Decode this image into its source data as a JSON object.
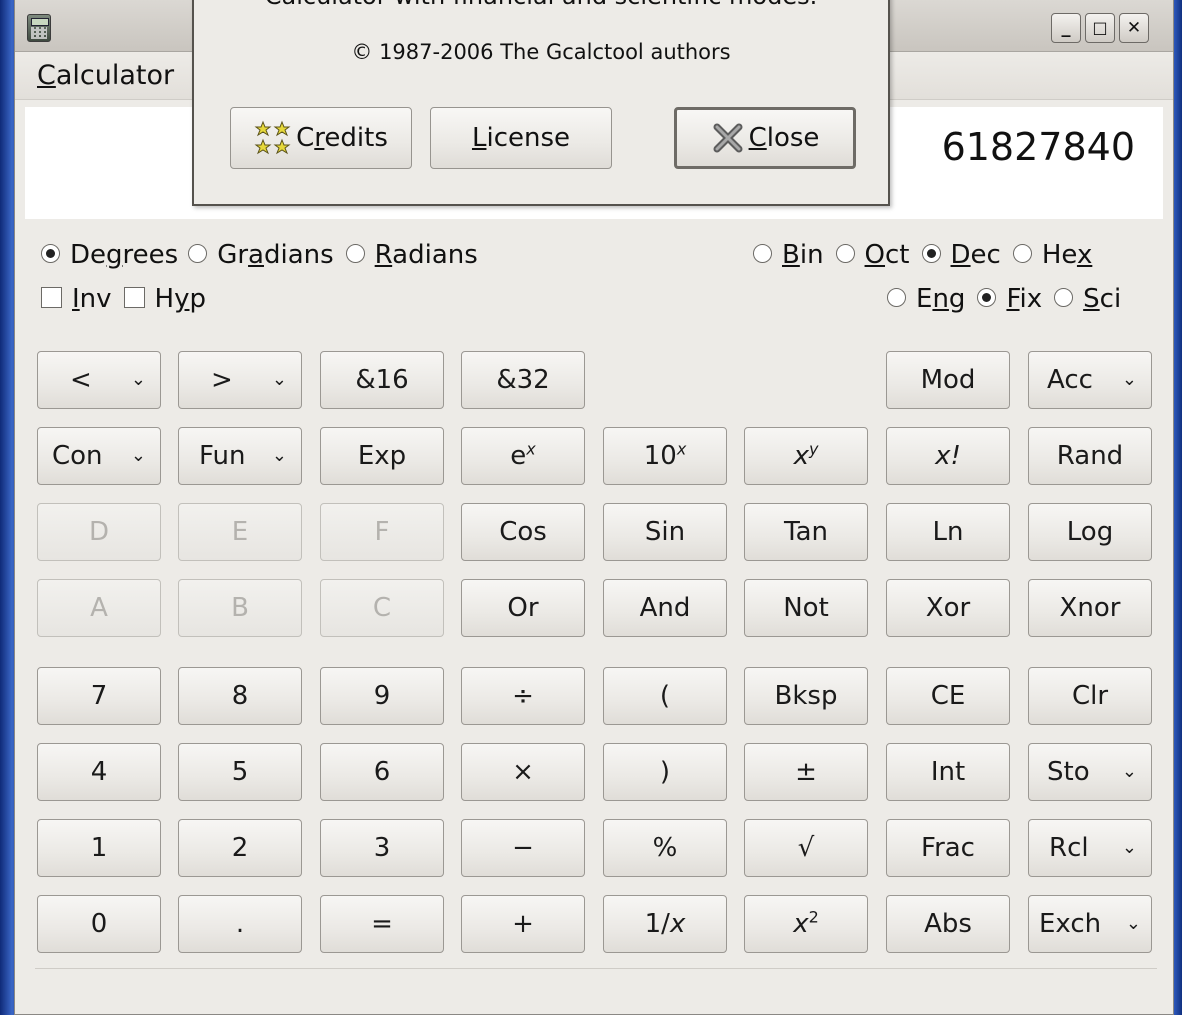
{
  "window": {
    "title_buttons": {
      "minimize": "_",
      "maximize": "□",
      "close": "✕"
    }
  },
  "menu": {
    "calculator": {
      "before": "",
      "mnemonic": "C",
      "after": "alculator"
    }
  },
  "display": {
    "value": "61827840"
  },
  "angle_modes": [
    {
      "pre": "De",
      "mn": "g",
      "post": "rees",
      "selected": true
    },
    {
      "pre": "Gr",
      "mn": "a",
      "post": "dians",
      "selected": false
    },
    {
      "pre": "",
      "mn": "R",
      "post": "adians",
      "selected": false
    }
  ],
  "base_modes": [
    {
      "pre": "",
      "mn": "B",
      "post": "in",
      "selected": false
    },
    {
      "pre": "",
      "mn": "O",
      "post": "ct",
      "selected": false
    },
    {
      "pre": "",
      "mn": "D",
      "post": "ec",
      "selected": true
    },
    {
      "pre": "He",
      "mn": "x",
      "post": "",
      "selected": false
    }
  ],
  "toggles": [
    {
      "pre": "",
      "mn": "I",
      "post": "nv",
      "checked": false
    },
    {
      "pre": "H",
      "mn": "y",
      "post": "p",
      "checked": false
    }
  ],
  "display_modes": [
    {
      "pre": "E",
      "mn": "n",
      "post": "g",
      "selected": false
    },
    {
      "pre": "",
      "mn": "F",
      "post": "ix",
      "selected": true
    },
    {
      "pre": "",
      "mn": "S",
      "post": "ci",
      "selected": false
    }
  ],
  "keys": {
    "shift_left": "<",
    "shift_right": ">",
    "and16": "&16",
    "and32": "&32",
    "mod": "Mod",
    "acc": "Acc",
    "con": "Con",
    "fun": "Fun",
    "exp": "Exp",
    "ex_base": "e",
    "ex_sup": "x",
    "tenx_base": "10",
    "tenx_sup": "x",
    "xy_base": "x",
    "xy_sup": "y",
    "fact": "x!",
    "rand": "Rand",
    "d": "D",
    "e": "E",
    "f": "F",
    "cos": "Cos",
    "sin": "Sin",
    "tan": "Tan",
    "ln": "Ln",
    "log": "Log",
    "a": "A",
    "b": "B",
    "c": "C",
    "or": "Or",
    "and": "And",
    "not": "Not",
    "xor": "Xor",
    "xnor": "Xnor",
    "k7": "7",
    "k8": "8",
    "k9": "9",
    "div": "÷",
    "lparen": "(",
    "bksp": "Bksp",
    "ce": "CE",
    "clr": "Clr",
    "k4": "4",
    "k5": "5",
    "k6": "6",
    "mul": "×",
    "rparen": ")",
    "pm": "±",
    "int": "Int",
    "sto": "Sto",
    "k1": "1",
    "k2": "2",
    "k3": "3",
    "sub": "−",
    "pct": "%",
    "sqrt": "√",
    "frac": "Frac",
    "rcl": "Rcl",
    "k0": "0",
    "dot": ".",
    "eq": "=",
    "add": "+",
    "recip_pre": "1/",
    "recip_x": "x",
    "sq_base": "x",
    "sq_sup": "2",
    "abs": "Abs",
    "exch": "Exch",
    "dd_arrow": "⌄"
  },
  "about": {
    "description": "Calculator with financial and scientific modes.",
    "copyright": "© 1987-2006 The Gcalctool authors",
    "credits": {
      "pre": "C",
      "mn": "r",
      "post": "edits"
    },
    "license": {
      "pre": "",
      "mn": "L",
      "post": "icense"
    },
    "close": {
      "pre": "",
      "mn": "C",
      "post": "lose"
    }
  }
}
